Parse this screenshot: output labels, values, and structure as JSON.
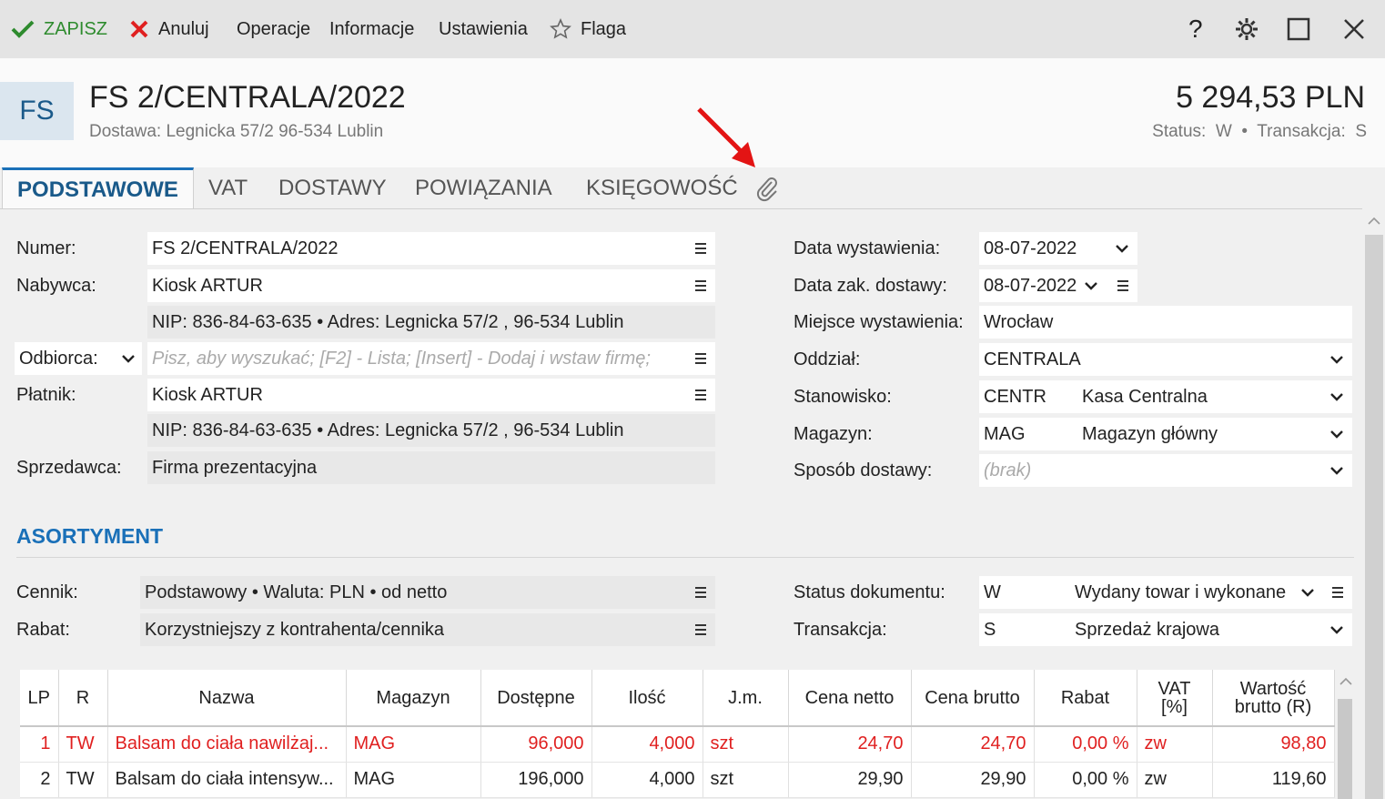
{
  "toolbar": {
    "save": "ZAPISZ",
    "cancel": "Anuluj",
    "operations": "Operacje",
    "information": "Informacje",
    "settings": "Ustawienia",
    "flag": "Flaga"
  },
  "header": {
    "badge": "FS",
    "title": "FS 2/CENTRALA/2022",
    "delivery": "Dostawa: Legnicka  57/2  96-534 Lublin",
    "amount": "5 294,53 PLN",
    "status_label": "Status:",
    "status_value": "W",
    "transaction_label": "Transakcja:",
    "transaction_value": "S"
  },
  "tabs": [
    "PODSTAWOWE",
    "VAT",
    "DOSTAWY",
    "POWIĄZANIA",
    "KSIĘGOWOŚĆ"
  ],
  "left": {
    "numer_label": "Numer:",
    "numer": "FS 2/CENTRALA/2022",
    "nabywca_label": "Nabywca:",
    "nabywca": "Kiosk ARTUR",
    "nabywca_info": "NIP:  836-84-63-635  •  Adres:  Legnicka  57/2 , 96-534 Lublin",
    "odbiorca_label": "Odbiorca:",
    "odbiorca_placeholder": "Pisz, aby wyszukać; [F2] - Lista; [Insert] - Dodaj i wstaw firmę;",
    "platnik_label": "Płatnik:",
    "platnik": "Kiosk ARTUR",
    "platnik_info": "NIP:  836-84-63-635  •  Adres:  Legnicka  57/2 , 96-534 Lublin",
    "sprzedawca_label": "Sprzedawca:",
    "sprzedawca": "Firma prezentacyjna"
  },
  "right": {
    "data_wyst_label": "Data wystawienia:",
    "data_wyst": "08-07-2022",
    "data_dost_label": "Data zak. dostawy:",
    "data_dost": "08-07-2022",
    "miejsce_label": "Miejsce wystawienia:",
    "miejsce": "Wrocław",
    "oddzial_label": "Oddział:",
    "oddzial": "CENTRALA",
    "stanowisko_label": "Stanowisko:",
    "stanowisko_code": "CENTR",
    "stanowisko_name": "Kasa Centralna",
    "magazyn_label": "Magazyn:",
    "magazyn_code": "MAG",
    "magazyn_name": "Magazyn główny",
    "sposob_label": "Sposób dostawy:",
    "sposob": "(brak)"
  },
  "asortyment": {
    "title": "ASORTYMENT",
    "cennik_label": "Cennik:",
    "cennik": "Podstawowy • Waluta: PLN • od netto",
    "rabat_label": "Rabat:",
    "rabat": "Korzystniejszy z kontrahenta/cennika",
    "status_label": "Status dokumentu:",
    "status_code": "W",
    "status_name": "Wydany towar i wykonane",
    "transakcja_label": "Transakcja:",
    "transakcja_code": "S",
    "transakcja_name": "Sprzedaż krajowa"
  },
  "grid": {
    "headers": [
      "LP",
      "R",
      "Nazwa",
      "Magazyn",
      "Dostępne",
      "Ilość",
      "J.m.",
      "Cena netto",
      "Cena brutto",
      "Rabat",
      "VAT\n[%]",
      "Wartość\nbrutto (R)"
    ],
    "rows": [
      [
        "1",
        "TW",
        "Balsam do ciała nawilżaj...",
        "MAG",
        "96,000",
        "4,000",
        "szt",
        "24,70",
        "24,70",
        "0,00 %",
        "zw",
        "98,80"
      ],
      [
        "2",
        "TW",
        "Balsam do ciała intensyw...",
        "MAG",
        "196,000",
        "4,000",
        "szt",
        "29,90",
        "29,90",
        "0,00 %",
        "zw",
        "119,60"
      ]
    ]
  },
  "colors": {
    "accent": "#1a70b8",
    "save_green": "#2e8b2e",
    "cancel_red": "#e02020",
    "row_red": "#e02020",
    "arrow_red": "#e31414"
  }
}
